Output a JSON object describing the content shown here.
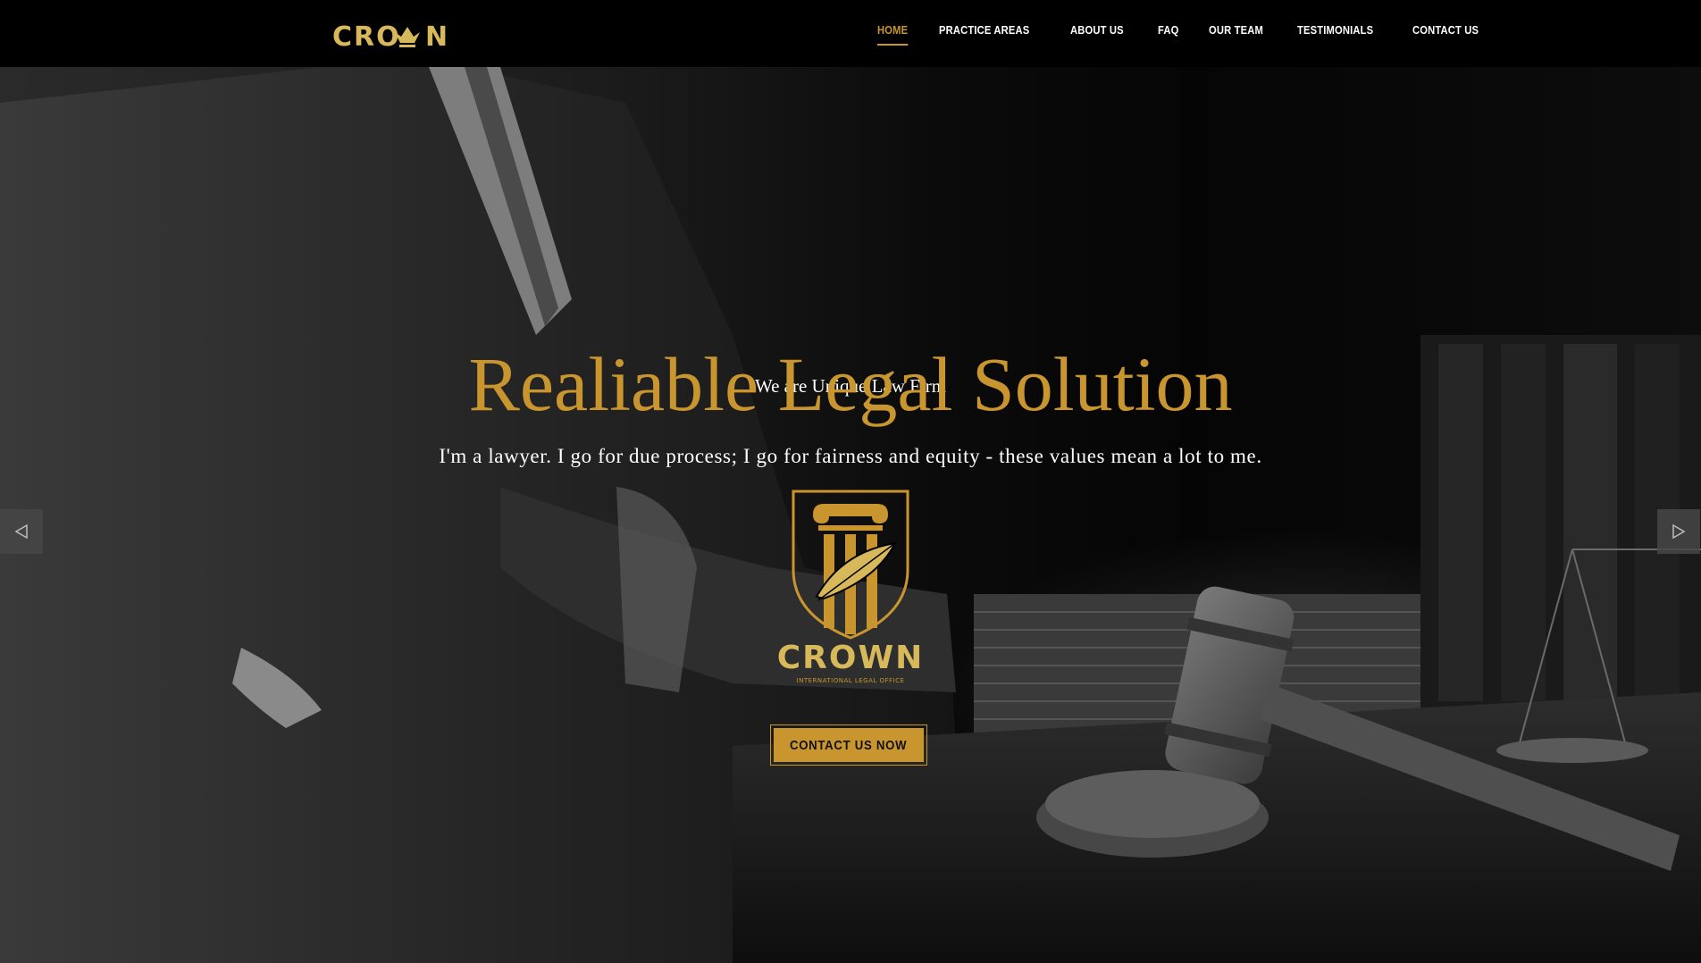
{
  "brand": {
    "logo_text": "CROWN"
  },
  "nav": {
    "items": [
      {
        "label": "HOME",
        "active": true
      },
      {
        "label": "PRACTICE AREAS",
        "active": false
      },
      {
        "label": "ABOUT US",
        "active": false
      },
      {
        "label": "FAQ",
        "active": false
      },
      {
        "label": "OUR TEAM",
        "active": false
      },
      {
        "label": "TESTIMONIALS",
        "active": false
      },
      {
        "label": "CONTACT US",
        "active": false
      }
    ]
  },
  "hero": {
    "eyebrow": "We are Unique Law Firm",
    "headline": "Realiable Legal Solution",
    "tagline": "I'm a lawyer. I go for due process; I go for fairness and equity - these values mean a lot to me.",
    "emblem_brand": "CROWN",
    "emblem_subtitle": "INTERNATIONAL LEGAL OFFICE",
    "cta_label": "CONTACT US NOW"
  },
  "icons": {
    "prev": "chevron-left-icon",
    "next": "chevron-right-icon",
    "emblem": "pillar-quill-shield-icon",
    "crown": "crown-icon"
  },
  "colors": {
    "accent": "#c8952f",
    "logo_gold": "#d7b85a",
    "background": "#000000",
    "text": "#ffffff"
  }
}
